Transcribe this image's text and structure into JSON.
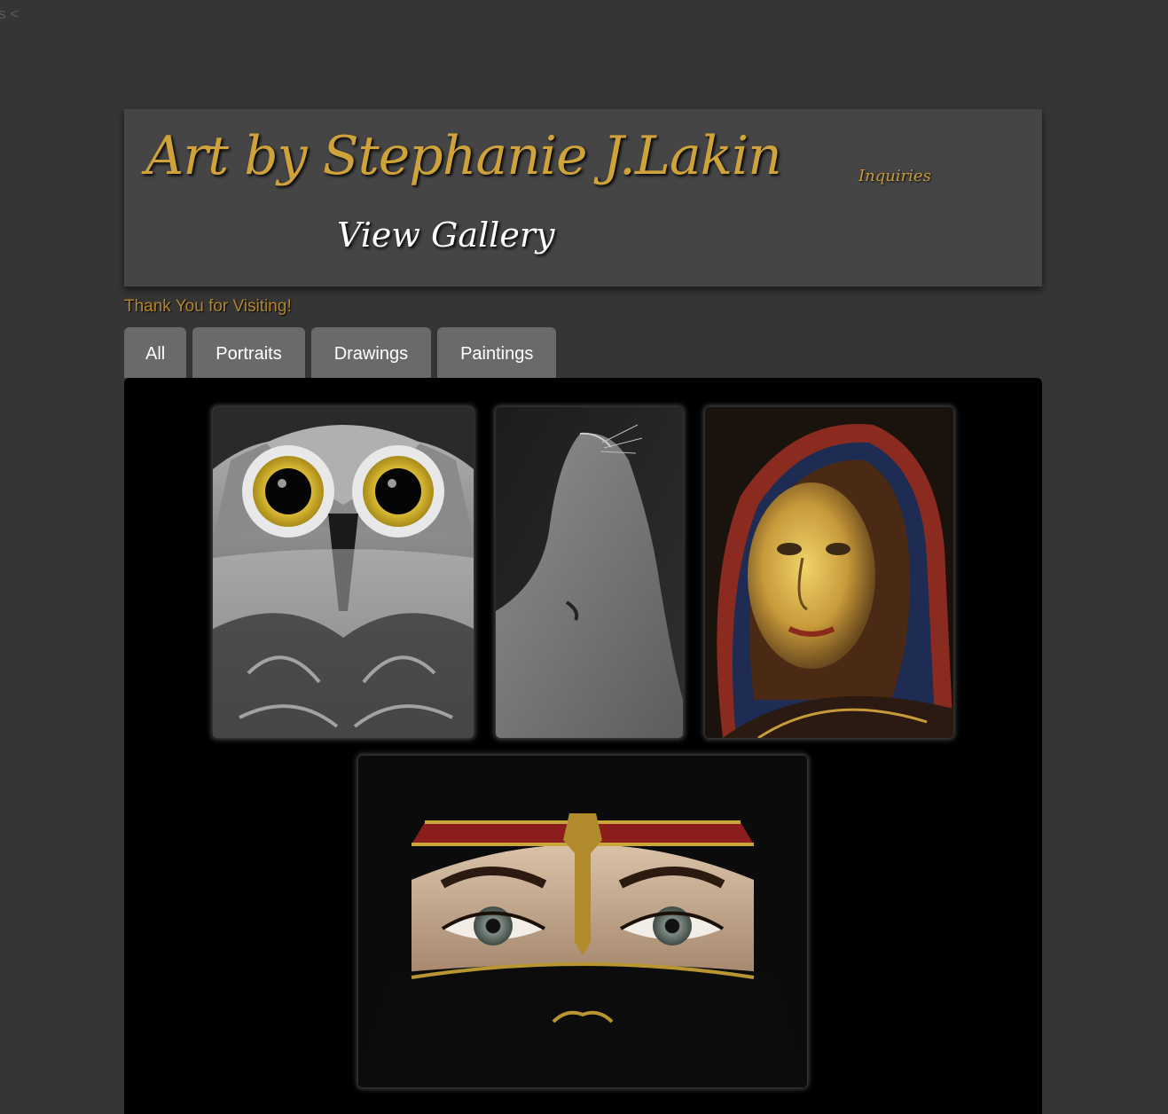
{
  "corner_text": "s <",
  "header": {
    "site_title": "Art by Stephanie J.Lakin",
    "inquiries_link": "Inquiries",
    "view_gallery_link": "View Gallery"
  },
  "tagline": "Thank You for Visiting!",
  "tabs": [
    {
      "label": "All"
    },
    {
      "label": "Portraits"
    },
    {
      "label": "Drawings"
    },
    {
      "label": "Paintings"
    }
  ],
  "gallery": {
    "artworks": [
      {
        "subject": "owl drawing"
      },
      {
        "subject": "seal drawing"
      },
      {
        "subject": "veiled woman portrait painting"
      },
      {
        "subject": "veiled woman eyes painting"
      }
    ]
  },
  "colors": {
    "page_background": "#353535",
    "header_background": "#454545",
    "title_gold": "#d0a33a",
    "tagline_gold": "#b3862d",
    "tab_background": "#6a6a6a",
    "gallery_background": "#000000"
  }
}
